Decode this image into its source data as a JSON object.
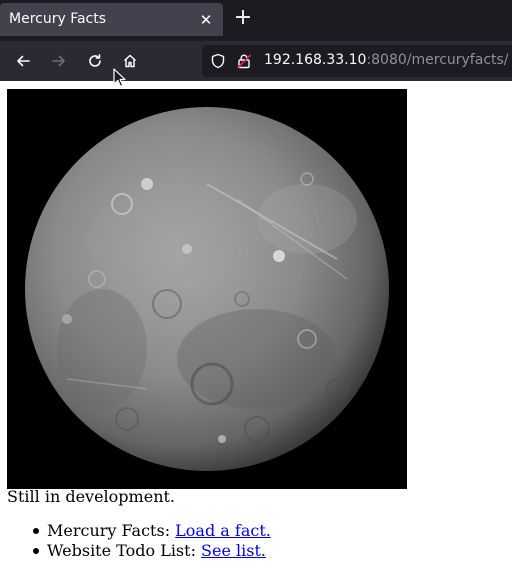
{
  "browser": {
    "tab_title": "Mercury Facts",
    "tab_close_icon": "close-icon",
    "new_tab_icon": "plus-icon",
    "url_host": "192.168.33.10",
    "url_rest": ":8080/mercuryfacts/",
    "nav_icons": [
      "back-arrow-icon",
      "forward-arrow-icon",
      "reload-icon",
      "home-icon"
    ],
    "colors": {
      "tabbar": "#1c1b22",
      "tab": "#42414d",
      "navbar": "#2b2a33",
      "urlbar": "#1c1b22",
      "insecure": "#e22850"
    }
  },
  "page": {
    "image_alt": "Mercury",
    "status_text": "Still in development.",
    "list": [
      {
        "label": "Mercury Facts: ",
        "link": "Load a fact."
      },
      {
        "label": "Website Todo List: ",
        "link": "See list."
      }
    ],
    "link_color": "#0000ee"
  }
}
